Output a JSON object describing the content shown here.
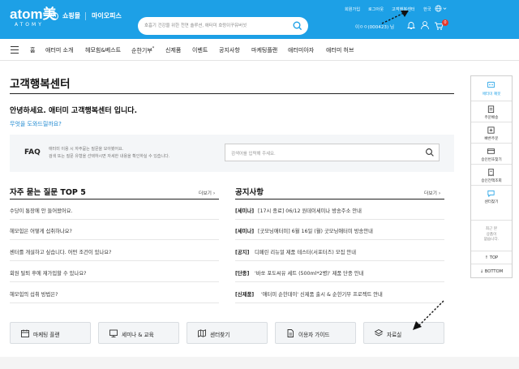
{
  "header": {
    "logo_main": "atom美",
    "logo_sub": "ATOMY",
    "brand_badge": "A",
    "nav_shopping": "쇼핑몰",
    "nav_myoffice": "마이오피스",
    "search_placeholder": "호흡기 건강을 위한 천연 솔루션, 애터미 호랑이꾸유버섯",
    "util": [
      "회원가입",
      "로그아웃",
      "고객행복센터",
      "한국"
    ],
    "user_name": "이ㅇㅇ(000423) 님",
    "cart_count": "0"
  },
  "gnb": [
    "홈",
    "애터미 소개",
    "헤모힘&베스트",
    "순한기부",
    "신제품",
    "이벤트",
    "공지사항",
    "마케팅플랜",
    "애터미아자",
    "애터미 허브"
  ],
  "gnb_mark": "*",
  "page": {
    "title": "고객행복센터",
    "greeting": "안녕하세요. 애터미 고객행복센터 입니다.",
    "help_link": "무엇을 도와드릴까요?"
  },
  "faq": {
    "label": "FAQ",
    "desc1": "애터미 이용 시 자주묻는 질문을 모아봤어요.",
    "desc2": "검색 또는 질문 유형을 선택하시면 자세한 내용을 확인하실 수 있습니다.",
    "placeholder": "검색어를 입력해 주세요."
  },
  "top5": {
    "title": "자주 묻는 질문 TOP 5",
    "more": "더보기 ›",
    "items": [
      "수당이 통장에 안 들어왔어요.",
      "헤모힘은 어떻게 섭취하나요?",
      "센터를 개설하고 싶습니다. 어떤 조건이 있나요?",
      "회원 탈퇴 후에 재가입할 수 있나요?",
      "헤모힘의 섭취 방법은?"
    ]
  },
  "notice": {
    "title": "공지사항",
    "more": "더보기 ›",
    "items": [
      {
        "tag": "[세미나]",
        "text": "[17시 종료] 06/12 원데이세미나 방송주소 안내"
      },
      {
        "tag": "[세미나]",
        "text": "[굿모닝애터미] 6월 16일 (월) 굿모닝애터미 방송안내"
      },
      {
        "tag": "[공지]",
        "text": "디페린 리뉴얼 제품 테스터(서포터즈) 모집 안내"
      },
      {
        "tag": "[단종]",
        "text": "'바쏘 포도씨유 세트 (500ml*2병)' 제품 단종 안내"
      },
      {
        "tag": "[신제품]",
        "text": "'애터미 순한데이' 신제품 출시 & 순한기부 프로젝트 안내"
      }
    ]
  },
  "quick_buttons": [
    "마케팅 플랜",
    "세미나 & 교육",
    "센터찾기",
    "이용자 가이드",
    "자료실"
  ],
  "quick_menu": {
    "items": [
      "애터미 혜봇",
      "주문배송",
      "빠른주문",
      "승인번호찾기",
      "승인전액조회",
      "센터찾기"
    ],
    "recent": [
      "최근 본",
      "상품이",
      "없습니다."
    ],
    "top": "↑ TOP",
    "bottom": "↓ BOTTOM"
  },
  "colors": {
    "brand": "#1da0e6",
    "badge": "#e5372b",
    "link": "#1d88d0"
  }
}
